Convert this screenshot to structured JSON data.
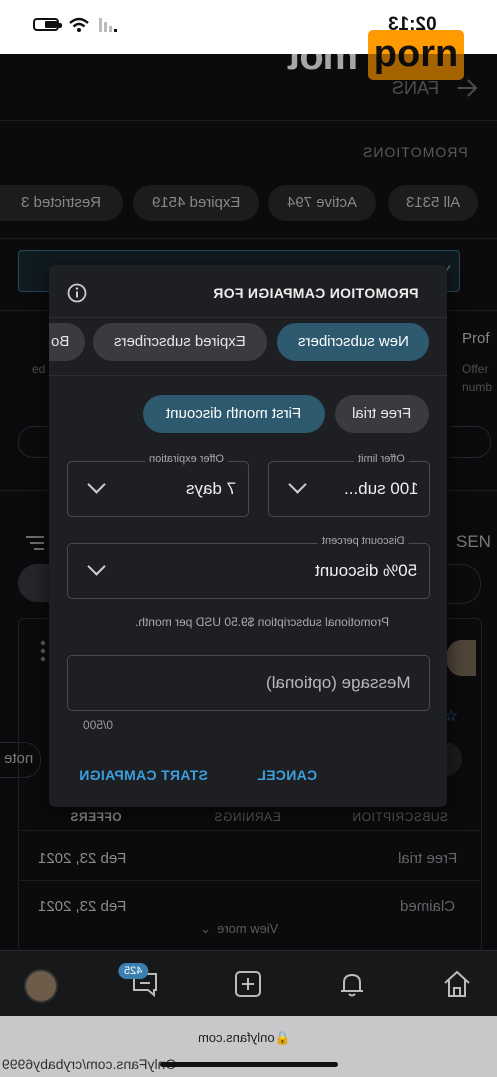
{
  "status": {
    "time": "02:13"
  },
  "brand": {
    "text_white": "mot",
    "text_box": "porn"
  },
  "header": {
    "back_label": "FANS",
    "section_title": "PROMOTIONS"
  },
  "filters": [
    {
      "label": "All 5313"
    },
    {
      "label": "Active 794"
    },
    {
      "label": "Expired 4519"
    },
    {
      "label": "Restricted 3"
    }
  ],
  "background": {
    "banner_fragment": "Y",
    "left_label": "Prof",
    "left_sub1": "Offer",
    "left_sub2": "numb",
    "right_sub": "ed",
    "side_label": "SEN",
    "note_fragment": "note"
  },
  "dialog": {
    "title": "PROMOTION CAMPAIGN FOR",
    "audience_tabs": [
      {
        "label": "New subscribers",
        "active": true
      },
      {
        "label": "Expired subscribers",
        "active": false
      },
      {
        "label": "Bo",
        "active": false
      }
    ],
    "type_tabs": [
      {
        "label": "Free trial",
        "active": false
      },
      {
        "label": "First month discount",
        "active": true
      }
    ],
    "offer_limit": {
      "label": "Offer limit",
      "value": "100 sub..."
    },
    "offer_expiration": {
      "label": "Offer expiration",
      "value": "7 days"
    },
    "discount": {
      "label": "Discount percent",
      "value": "50% discount"
    },
    "promo_note": "Promotional subscription $9.50 USD per month.",
    "message": {
      "placeholder": "Message (optional)",
      "counter": "0/500"
    },
    "cancel_label": "CANCEL",
    "start_label": "START CAMPAIGN"
  },
  "table": {
    "headers": [
      "SUBSCRIPTION",
      "EARNINGS",
      "OFFERS"
    ],
    "rows": [
      {
        "type": "Free trial",
        "date": "Feb 23, 2021"
      },
      {
        "type": "Claimed",
        "date": "Feb 23, 2021"
      }
    ],
    "view_more": "View more"
  },
  "nav": {
    "badge": "425"
  },
  "browser": {
    "domain": "onlyfans.com",
    "url": "OnlyFans.com/crybaby6999"
  },
  "colors": {
    "accent": "#3aa0e0",
    "active_pill": "#2d5a6f",
    "brand_orange": "#ff9a00"
  }
}
